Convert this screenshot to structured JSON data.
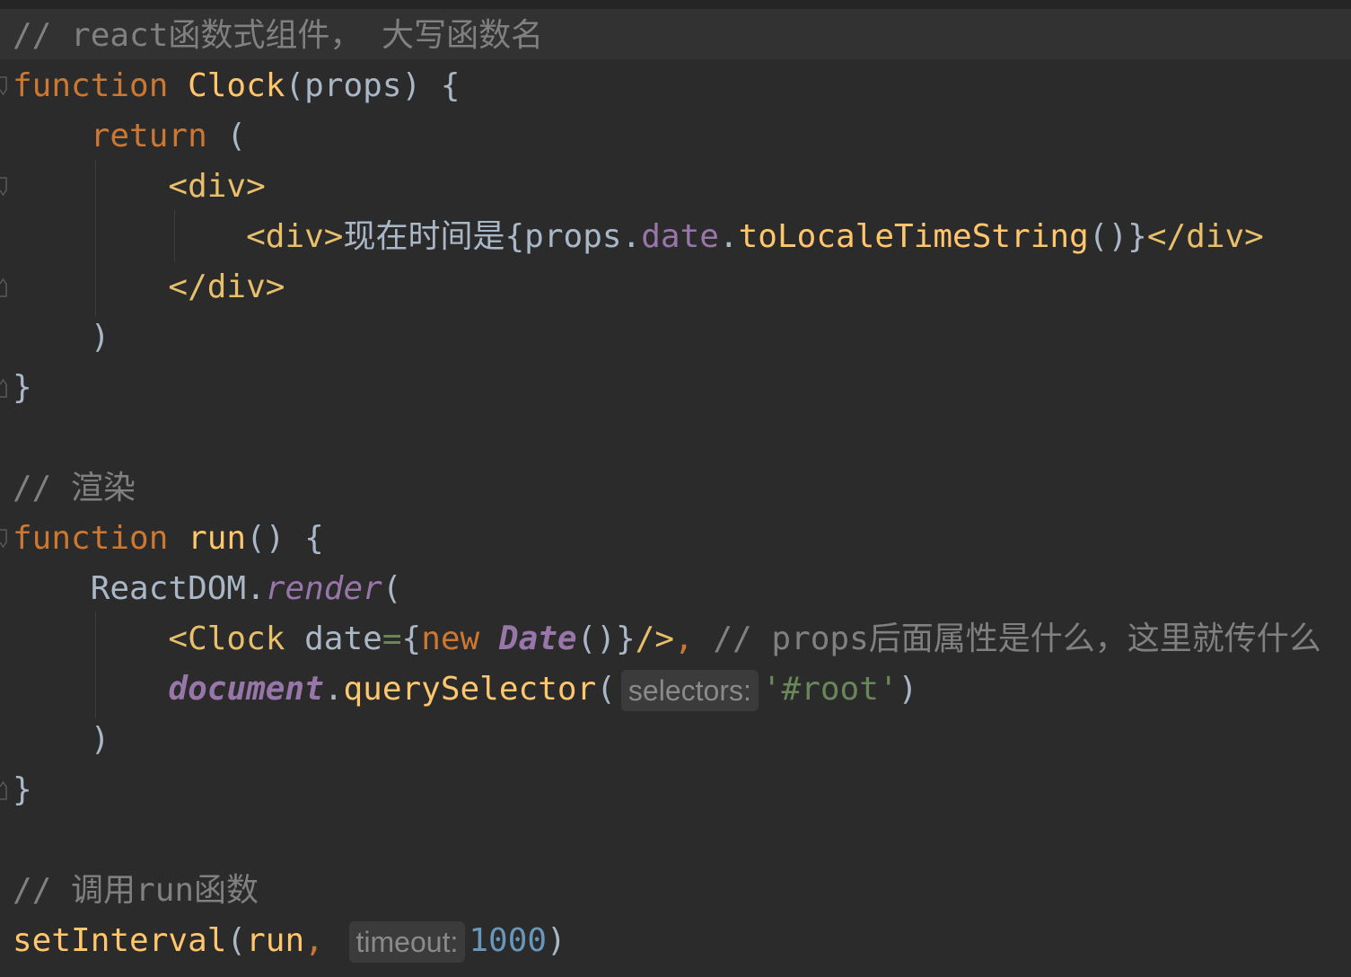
{
  "code": {
    "l1_comment": "// react函数式组件， 大写函数名",
    "l2_kw": "function",
    "l2_name": "Clock",
    "l2_rest": "(props) {",
    "l3_kw": "return",
    "l3_rest": " (",
    "l4_tag": "<div>",
    "l5_tag_open": "<div>",
    "l5_text": "现在时间是",
    "l5_brace_open": "{",
    "l5_obj": "props",
    "l5_dot1": ".",
    "l5_prop": "date",
    "l5_dot2": ".",
    "l5_method": "toLocaleTimeString",
    "l5_call": "()",
    "l5_brace_close": "}",
    "l5_tag_close": "</div>",
    "l6_tag": "</div>",
    "l7_paren": ")",
    "l8_brace": "}",
    "l10_comment": "// 渲染",
    "l11_kw": "function",
    "l11_name": "run",
    "l11_rest": "() {",
    "l12_obj": "ReactDOM",
    "l12_dot": ".",
    "l12_method": "render",
    "l12_paren": "(",
    "l13_tag_open": "<Clock",
    "l13_attr": " date",
    "l13_eq": "=",
    "l13_brace_open": "{",
    "l13_new": "new",
    "l13_space": " ",
    "l13_cls": "Date",
    "l13_call": "()",
    "l13_brace_close": "}",
    "l13_tag_close": "/>",
    "l13_comma": ",",
    "l13_comment": " // props后面属性是什么，这里就传什么",
    "l14_obj": "document",
    "l14_dot": ".",
    "l14_method": "querySelector",
    "l14_paren_open": "(",
    "l14_hint": "selectors:",
    "l14_str": "'#root'",
    "l14_paren_close": ")",
    "l15_paren": ")",
    "l16_brace": "}",
    "l18_comment": "// 调用run函数",
    "l19_fn": "setInterval",
    "l19_paren_open": "(",
    "l19_arg": "run",
    "l19_comma": ",",
    "l19_hint": "timeout:",
    "l19_num": "1000",
    "l19_paren_close": ")"
  },
  "colors": {
    "background": "#2b2b2b",
    "keyword": "#cc7832",
    "function": "#ffc66d",
    "tag": "#e8bf6a",
    "comment": "#808080",
    "property": "#9876aa",
    "string": "#6a8759",
    "number": "#6897bb",
    "text": "#a9b7c6"
  }
}
